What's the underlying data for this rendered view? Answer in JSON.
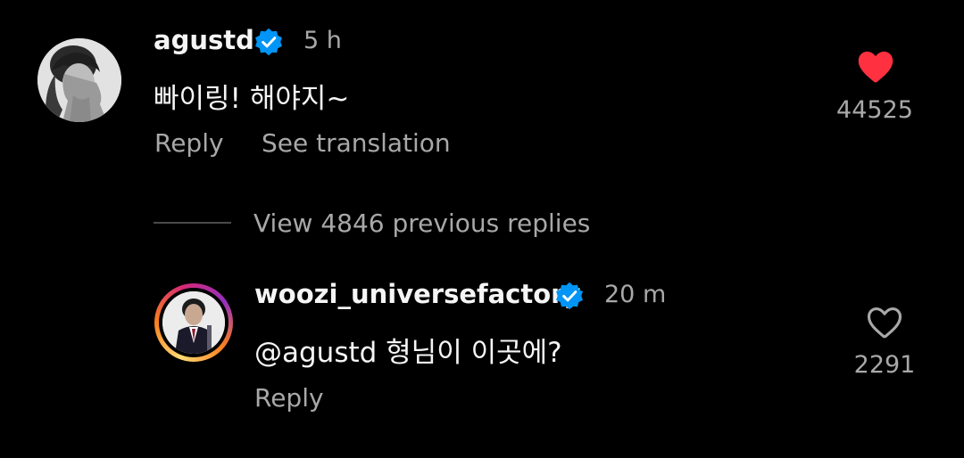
{
  "comment": {
    "username": "agustd",
    "time": "5 h",
    "text": "빠이링! 해야지~",
    "reply_label": "Reply",
    "translate_label": "See translation",
    "like_count": "44525",
    "liked": true,
    "like_color": "#ff3040"
  },
  "view_replies": {
    "label": "View 4846 previous replies"
  },
  "reply": {
    "username": "woozi_universefactory",
    "time": "20 m",
    "text": "@agustd 형님이 이곳에?",
    "reply_label": "Reply",
    "like_count": "2291",
    "liked": false
  },
  "colors": {
    "background": "#000000",
    "primary_text": "#f5f5f5",
    "secondary_text": "#a8a8a8",
    "verified_badge": "#0095f6"
  }
}
